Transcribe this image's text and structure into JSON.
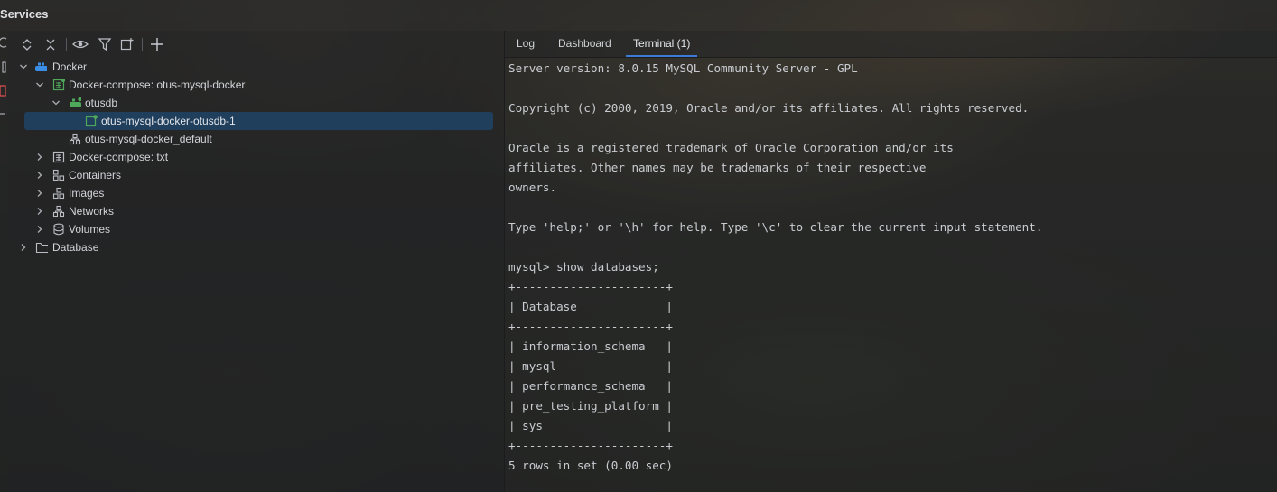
{
  "window": {
    "title": "Services"
  },
  "toolbar": {
    "buttons": [
      {
        "name": "expand-all-icon"
      },
      {
        "name": "collapse-all-icon"
      },
      {
        "name": "eye-icon"
      },
      {
        "name": "filter-icon"
      },
      {
        "name": "new-group-icon"
      },
      {
        "name": "add-service-icon"
      }
    ]
  },
  "tree": {
    "items": [
      {
        "label": "Docker",
        "icon": "docker-icon",
        "expanded": true
      },
      {
        "label": "Docker-compose: otus-mysql-docker",
        "icon": "docker-compose-icon",
        "expanded": true
      },
      {
        "label": "otusdb",
        "icon": "service-icon",
        "expanded": true
      },
      {
        "label": "otus-mysql-docker-otusdb-1",
        "icon": "container-running-icon",
        "selected": true
      },
      {
        "label": "otus-mysql-docker_default",
        "icon": "network-icon"
      },
      {
        "label": "Docker-compose: txt",
        "icon": "docker-compose-icon",
        "expanded": false
      },
      {
        "label": "Containers",
        "icon": "containers-icon",
        "expanded": false
      },
      {
        "label": "Images",
        "icon": "images-icon",
        "expanded": false
      },
      {
        "label": "Networks",
        "icon": "networks-icon",
        "expanded": false
      },
      {
        "label": "Volumes",
        "icon": "volumes-icon",
        "expanded": false
      },
      {
        "label": "Database",
        "icon": "folder-icon",
        "expanded": false
      }
    ]
  },
  "tabs": [
    {
      "label": "Log"
    },
    {
      "label": "Dashboard"
    },
    {
      "label": "Terminal (1)",
      "active": true
    }
  ],
  "terminal": {
    "lines": [
      "Server version: 8.0.15 MySQL Community Server - GPL",
      "",
      "Copyright (c) 2000, 2019, Oracle and/or its affiliates. All rights reserved.",
      "",
      "Oracle is a registered trademark of Oracle Corporation and/or its",
      "affiliates. Other names may be trademarks of their respective",
      "owners.",
      "",
      "Type 'help;' or '\\h' for help. Type '\\c' to clear the current input statement.",
      "",
      "mysql> show databases;",
      "+----------------------+",
      "| Database             |",
      "+----------------------+",
      "| information_schema   |",
      "| mysql                |",
      "| performance_schema   |",
      "| pre_testing_platform |",
      "| sys                  |",
      "+----------------------+",
      "5 rows in set (0.00 sec)"
    ]
  },
  "colors": {
    "selection": "#1f3f5d",
    "docker_blue": "#3a8ee6",
    "running_green": "#4fa85a",
    "active_tab_underline": "#3d7bd8"
  }
}
